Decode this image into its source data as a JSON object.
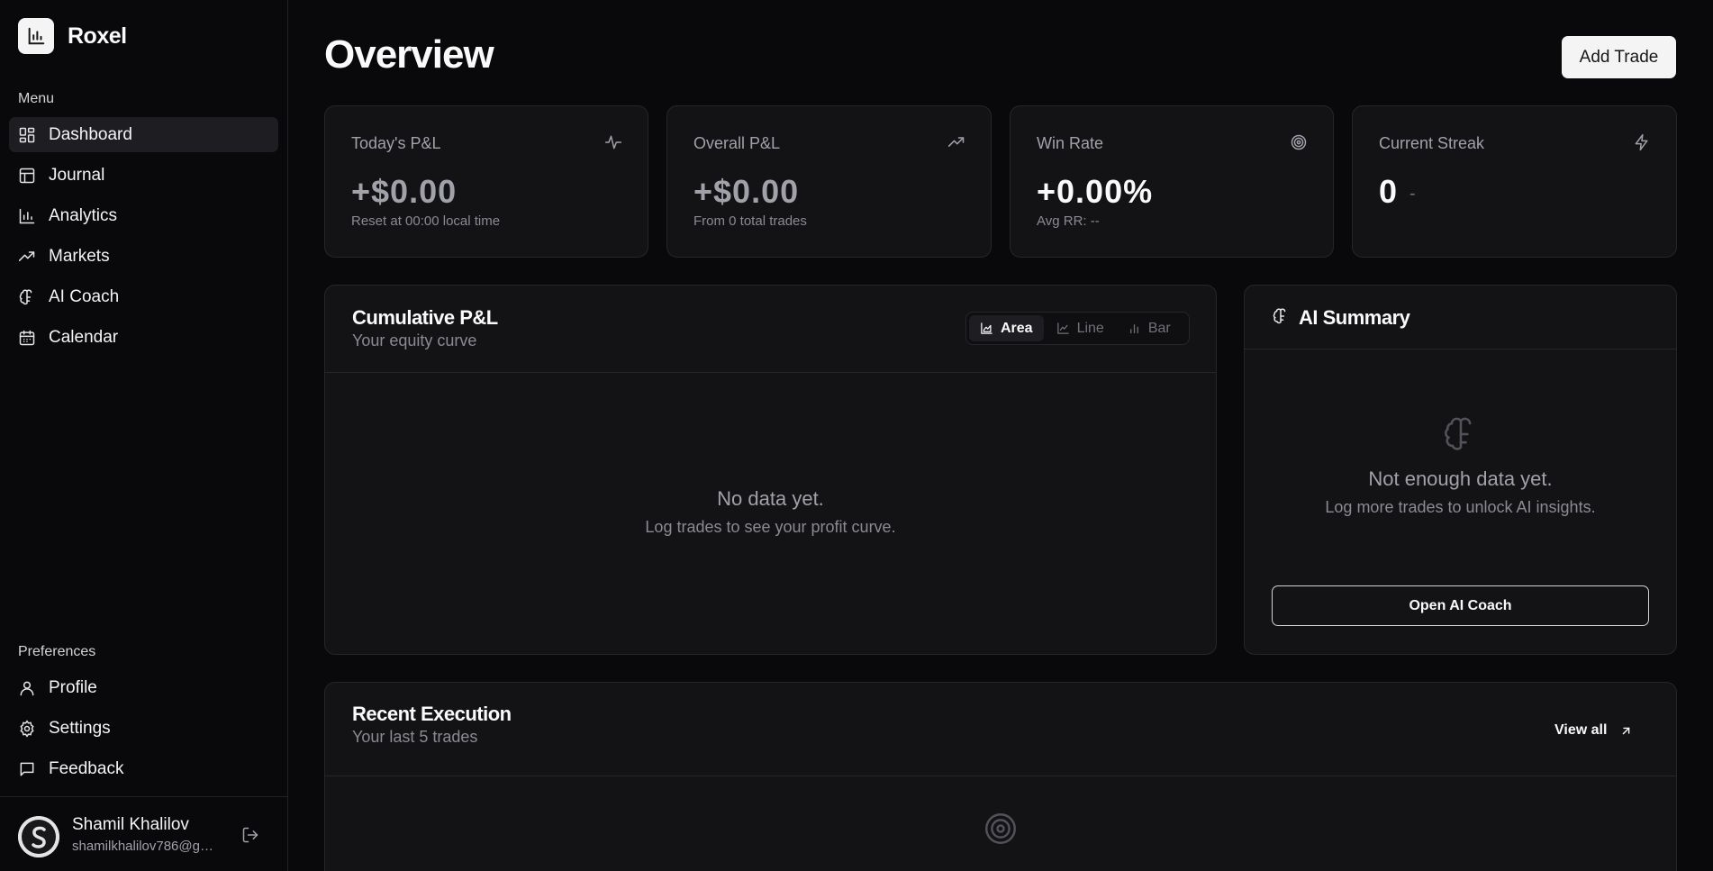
{
  "brand": {
    "name": "Roxel"
  },
  "sidebar": {
    "menu_label": "Menu",
    "menu_items": [
      {
        "label": "Dashboard",
        "icon": "grid-icon",
        "active": true
      },
      {
        "label": "Journal",
        "icon": "table-icon"
      },
      {
        "label": "Analytics",
        "icon": "bar-chart-icon"
      },
      {
        "label": "Markets",
        "icon": "trending-up-icon"
      },
      {
        "label": "AI Coach",
        "icon": "brain-icon"
      },
      {
        "label": "Calendar",
        "icon": "calendar-icon"
      }
    ],
    "preferences_label": "Preferences",
    "preference_items": [
      {
        "label": "Profile",
        "icon": "user-icon"
      },
      {
        "label": "Settings",
        "icon": "gear-icon"
      },
      {
        "label": "Feedback",
        "icon": "message-square-icon"
      }
    ]
  },
  "user": {
    "name": "Shamil Khalilov",
    "email": "shamilkhalilov786@gmail.com"
  },
  "header": {
    "title": "Overview",
    "add_trade_label": "Add Trade"
  },
  "stats": [
    {
      "label": "Today's P&L",
      "value": "+$0.00",
      "sub": "Reset at 00:00 local time",
      "icon": "activity-icon"
    },
    {
      "label": "Overall P&L",
      "value": "+$0.00",
      "sub": "From 0 total trades",
      "icon": "trending-up-icon"
    },
    {
      "label": "Win Rate",
      "value": "+0.00%",
      "sub": "Avg RR: --",
      "icon": "target-icon"
    },
    {
      "label": "Current Streak",
      "value": "0",
      "sub": "-",
      "icon": "zap-icon"
    }
  ],
  "pnl_card": {
    "title": "Cumulative P&L",
    "subtitle": "Your equity curve",
    "chart_modes": [
      "Area",
      "Line",
      "Bar"
    ],
    "active_mode": "Area",
    "empty_title": "No data yet.",
    "empty_sub": "Log trades to see your profit curve."
  },
  "ai_summary": {
    "title": "AI Summary",
    "empty_title": "Not enough data yet.",
    "empty_sub": "Log more trades to unlock AI insights.",
    "button_label": "Open AI Coach"
  },
  "recent": {
    "title": "Recent Execution",
    "subtitle": "Your last 5 trades",
    "view_all_label": "View all"
  },
  "colors": {
    "background": "#09090b",
    "card": "#131316",
    "border": "#26262a",
    "accent": "#f4f4f5"
  }
}
